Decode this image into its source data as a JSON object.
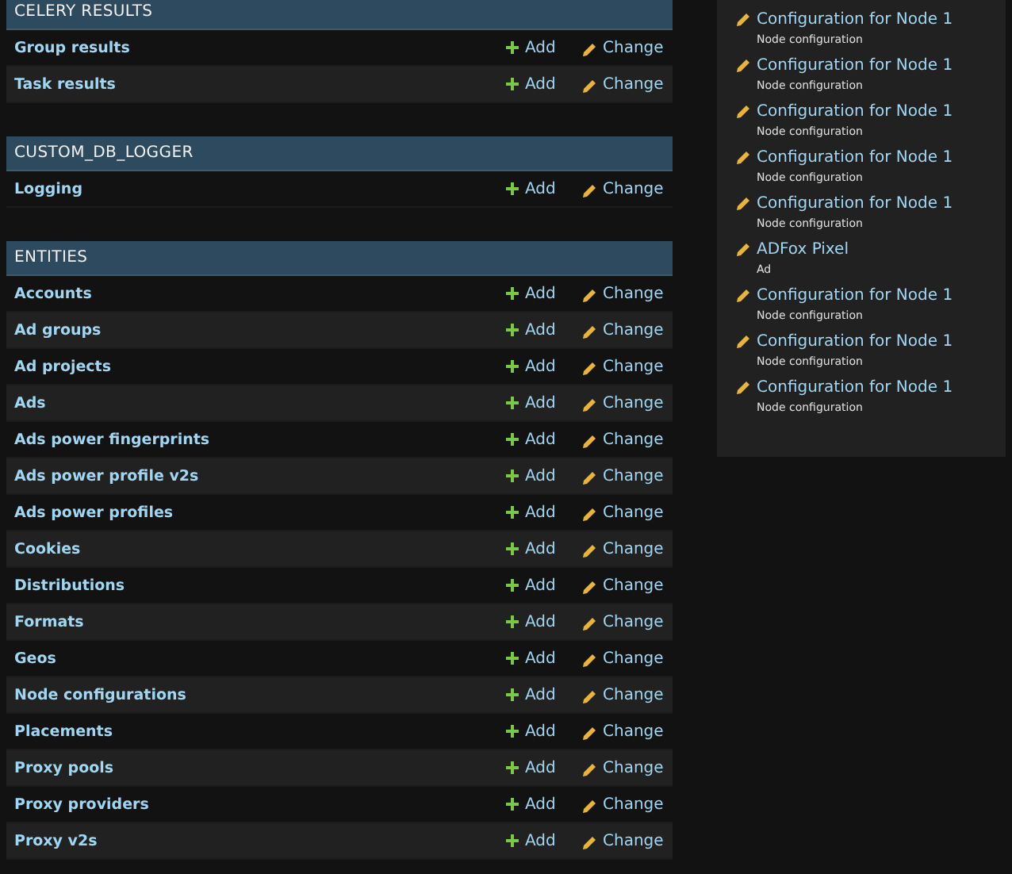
{
  "modules": [
    {
      "caption": "CELERY RESULTS",
      "models": [
        {
          "name": "Group results",
          "add": "Add",
          "change": "Change"
        },
        {
          "name": "Task results",
          "add": "Add",
          "change": "Change"
        }
      ]
    },
    {
      "caption": "CUSTOM_DB_LOGGER",
      "models": [
        {
          "name": "Logging",
          "add": "Add",
          "change": "Change"
        }
      ]
    },
    {
      "caption": "ENTITIES",
      "models": [
        {
          "name": "Accounts",
          "add": "Add",
          "change": "Change"
        },
        {
          "name": "Ad groups",
          "add": "Add",
          "change": "Change"
        },
        {
          "name": "Ad projects",
          "add": "Add",
          "change": "Change"
        },
        {
          "name": "Ads",
          "add": "Add",
          "change": "Change"
        },
        {
          "name": "Ads power fingerprints",
          "add": "Add",
          "change": "Change"
        },
        {
          "name": "Ads power profile v2s",
          "add": "Add",
          "change": "Change"
        },
        {
          "name": "Ads power profiles",
          "add": "Add",
          "change": "Change"
        },
        {
          "name": "Cookies",
          "add": "Add",
          "change": "Change"
        },
        {
          "name": "Distributions",
          "add": "Add",
          "change": "Change"
        },
        {
          "name": "Formats",
          "add": "Add",
          "change": "Change"
        },
        {
          "name": "Geos",
          "add": "Add",
          "change": "Change"
        },
        {
          "name": "Node configurations",
          "add": "Add",
          "change": "Change"
        },
        {
          "name": "Placements",
          "add": "Add",
          "change": "Change"
        },
        {
          "name": "Proxy pools",
          "add": "Add",
          "change": "Change"
        },
        {
          "name": "Proxy providers",
          "add": "Add",
          "change": "Change"
        },
        {
          "name": "Proxy v2s",
          "add": "Add",
          "change": "Change"
        }
      ]
    }
  ],
  "recent_actions": [
    {
      "title": "Configuration for Node 1",
      "type": "Node configuration"
    },
    {
      "title": "Configuration for Node 1",
      "type": "Node configuration"
    },
    {
      "title": "Configuration for Node 1",
      "type": "Node configuration"
    },
    {
      "title": "Configuration for Node 1",
      "type": "Node configuration"
    },
    {
      "title": "Configuration for Node 1",
      "type": "Node configuration"
    },
    {
      "title": "ADFox Pixel",
      "type": "Ad"
    },
    {
      "title": "Configuration for Node 1",
      "type": "Node configuration"
    },
    {
      "title": "Configuration for Node 1",
      "type": "Node configuration"
    },
    {
      "title": "Configuration for Node 1",
      "type": "Node configuration"
    }
  ]
}
